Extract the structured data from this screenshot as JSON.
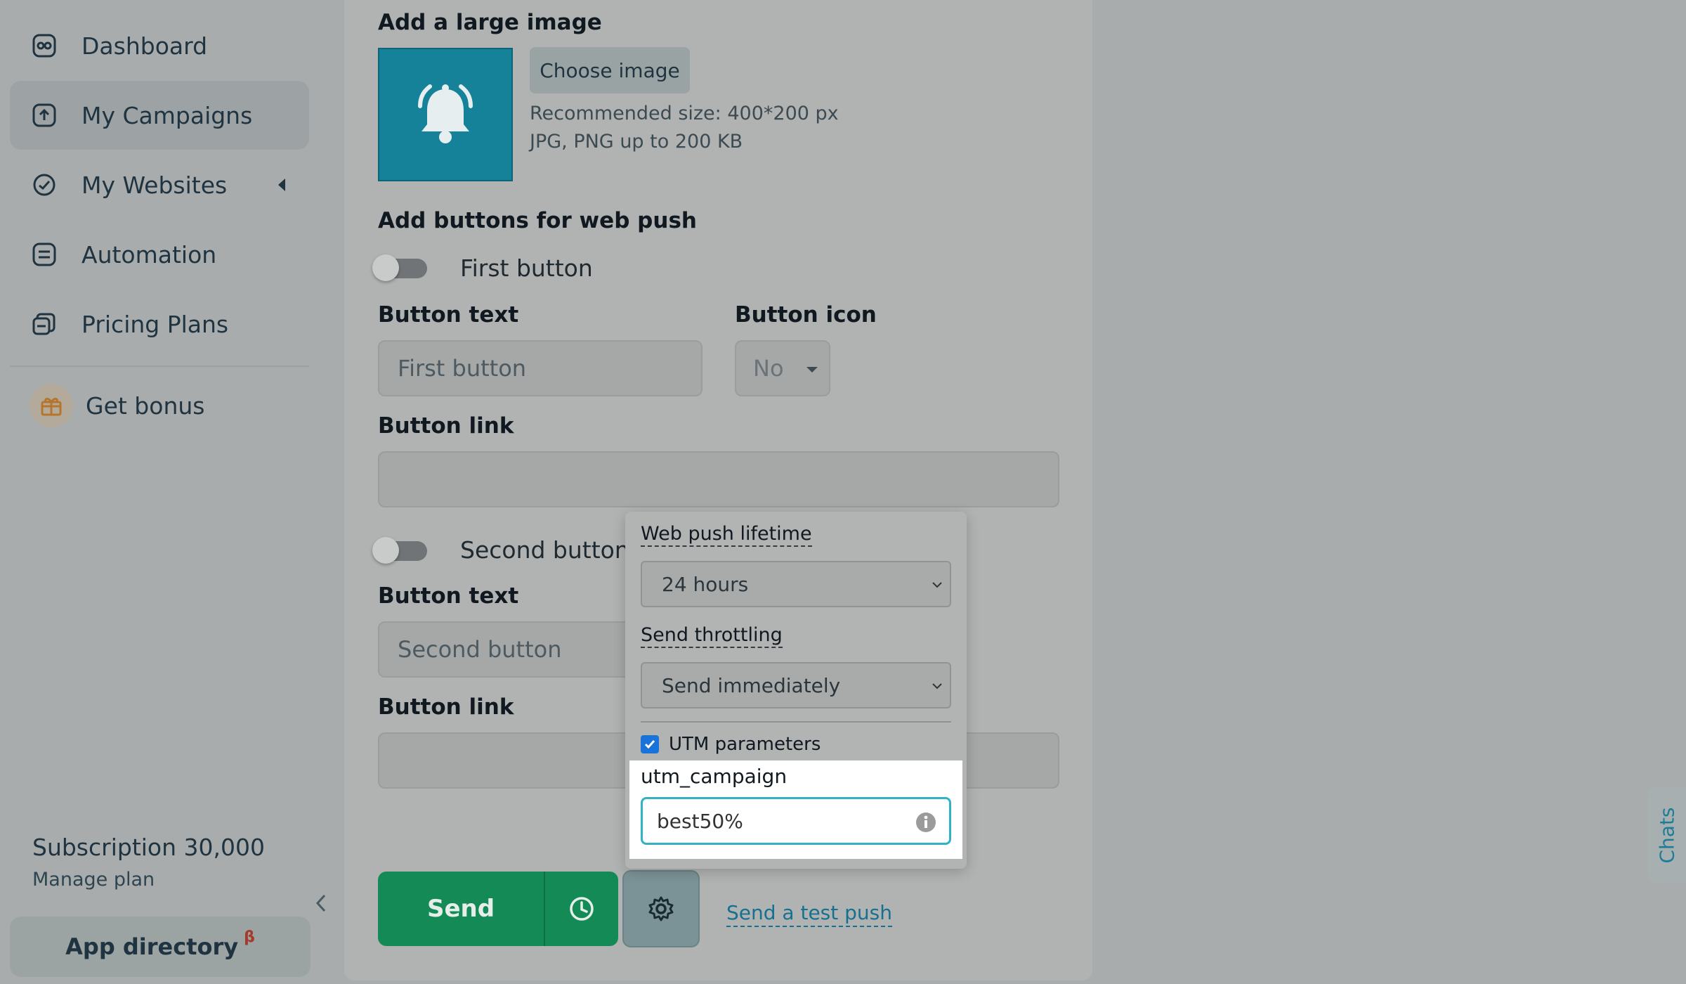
{
  "sidebar": {
    "items": [
      {
        "label": "Dashboard",
        "icon": "dashboard-icon"
      },
      {
        "label": "My Campaigns",
        "icon": "campaigns-icon",
        "active": true
      },
      {
        "label": "My Websites",
        "icon": "websites-icon"
      },
      {
        "label": "Automation",
        "icon": "automation-icon"
      },
      {
        "label": "Pricing Plans",
        "icon": "pricing-icon"
      }
    ],
    "bonus_label": "Get bonus",
    "subscription": "Subscription 30,000",
    "manage_plan": "Manage plan",
    "app_directory": "App directory",
    "app_directory_badge": "β"
  },
  "main": {
    "large_image_title": "Add a large image",
    "choose_image": "Choose image",
    "recommended_size": "Recommended size: 400*200 px",
    "file_formats": "JPG, PNG up to 200 KB",
    "buttons_title": "Add buttons for web push",
    "first_button": {
      "toggle_label": "First button",
      "text_label": "Button text",
      "text_placeholder": "First button",
      "icon_label": "Button icon",
      "icon_value": "No",
      "link_label": "Button link"
    },
    "second_button": {
      "toggle_label": "Second button",
      "text_label": "Button text",
      "text_placeholder": "Second button",
      "link_label": "Button link"
    },
    "send_label": "Send",
    "test_push": "Send a test push"
  },
  "popup": {
    "lifetime_label": "Web push lifetime",
    "lifetime_value": "24 hours",
    "throttling_label": "Send throttling",
    "throttling_value": "Send immediately",
    "utm_label": "UTM parameters",
    "utm_checked": true,
    "utm_campaign_label": "utm_campaign",
    "utm_campaign_value": "best50%"
  },
  "chats_tab": "Chats",
  "colors": {
    "accent_green": "#148a57",
    "link_blue": "#167190",
    "focus_cyan": "#31b3c6",
    "image_teal": "#16829a"
  }
}
